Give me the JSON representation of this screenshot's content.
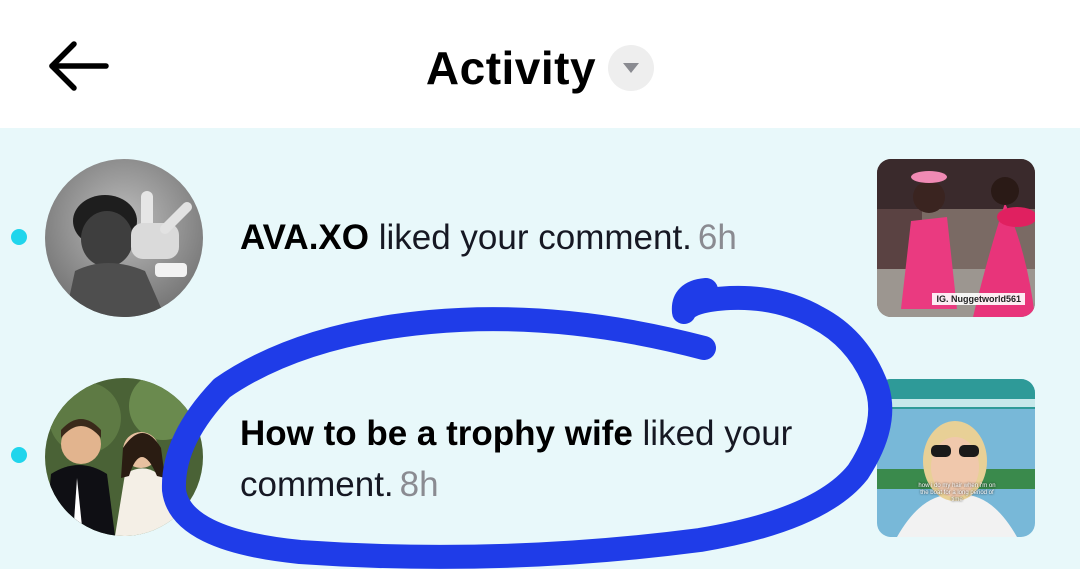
{
  "header": {
    "title": "Activity",
    "back_icon": "arrow-left-icon",
    "dropdown_icon": "caret-down-icon"
  },
  "colors": {
    "unread_dot": "#20d5ec",
    "list_background": "#e8f8fa",
    "time_text": "#8a8b91",
    "scribble": "#1f3ce8"
  },
  "notifications": [
    {
      "username": "AVA.XO",
      "action": " liked your comment.",
      "time": "6h",
      "thumbnail_watermark": "IG. Nuggetworld561"
    },
    {
      "username": "How to be a trophy wife",
      "action": " liked your comment.",
      "time": "8h",
      "thumbnail_caption": "how i do my hair when i'm on the boat for a long period of time"
    }
  ]
}
